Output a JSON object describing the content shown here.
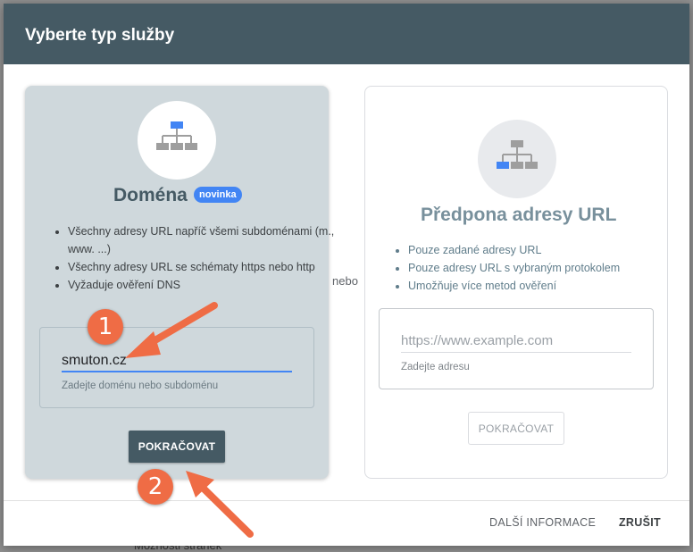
{
  "dialog": {
    "title": "Vyberte typ služby",
    "or_label": "nebo"
  },
  "domain_card": {
    "title": "Doména",
    "badge": "novinka",
    "bullets": [
      "Všechny adresy URL napříč všemi subdoménami (m., www. ...)",
      "Všechny adresy URL se schématy https nebo http",
      "Vyžaduje ověření DNS"
    ],
    "input_value": "smuton.cz",
    "input_help": "Zadejte doménu nebo subdoménu",
    "continue_label": "POKRAČOVAT"
  },
  "prefix_card": {
    "title": "Předpona adresy URL",
    "bullets": [
      "Pouze zadané adresy URL",
      "Pouze adresy URL s vybraným protokolem",
      "Umožňuje více metod ověření"
    ],
    "input_placeholder": "https://www.example.com",
    "input_help": "Zadejte adresu",
    "continue_label": "POKRAČOVAT"
  },
  "footer": {
    "more_info": "DALŠÍ INFORMACE",
    "cancel": "ZRUŠIT"
  },
  "annotations": {
    "step1": "1",
    "step2": "2"
  },
  "background": {
    "peek_text": "Možnosti stránek"
  },
  "colors": {
    "header": "#455a64",
    "accent": "#4285f4",
    "annotation": "#ef6c45",
    "domain_card_bg": "#cfd8dc"
  },
  "icons": [
    "sitemap-icon"
  ]
}
